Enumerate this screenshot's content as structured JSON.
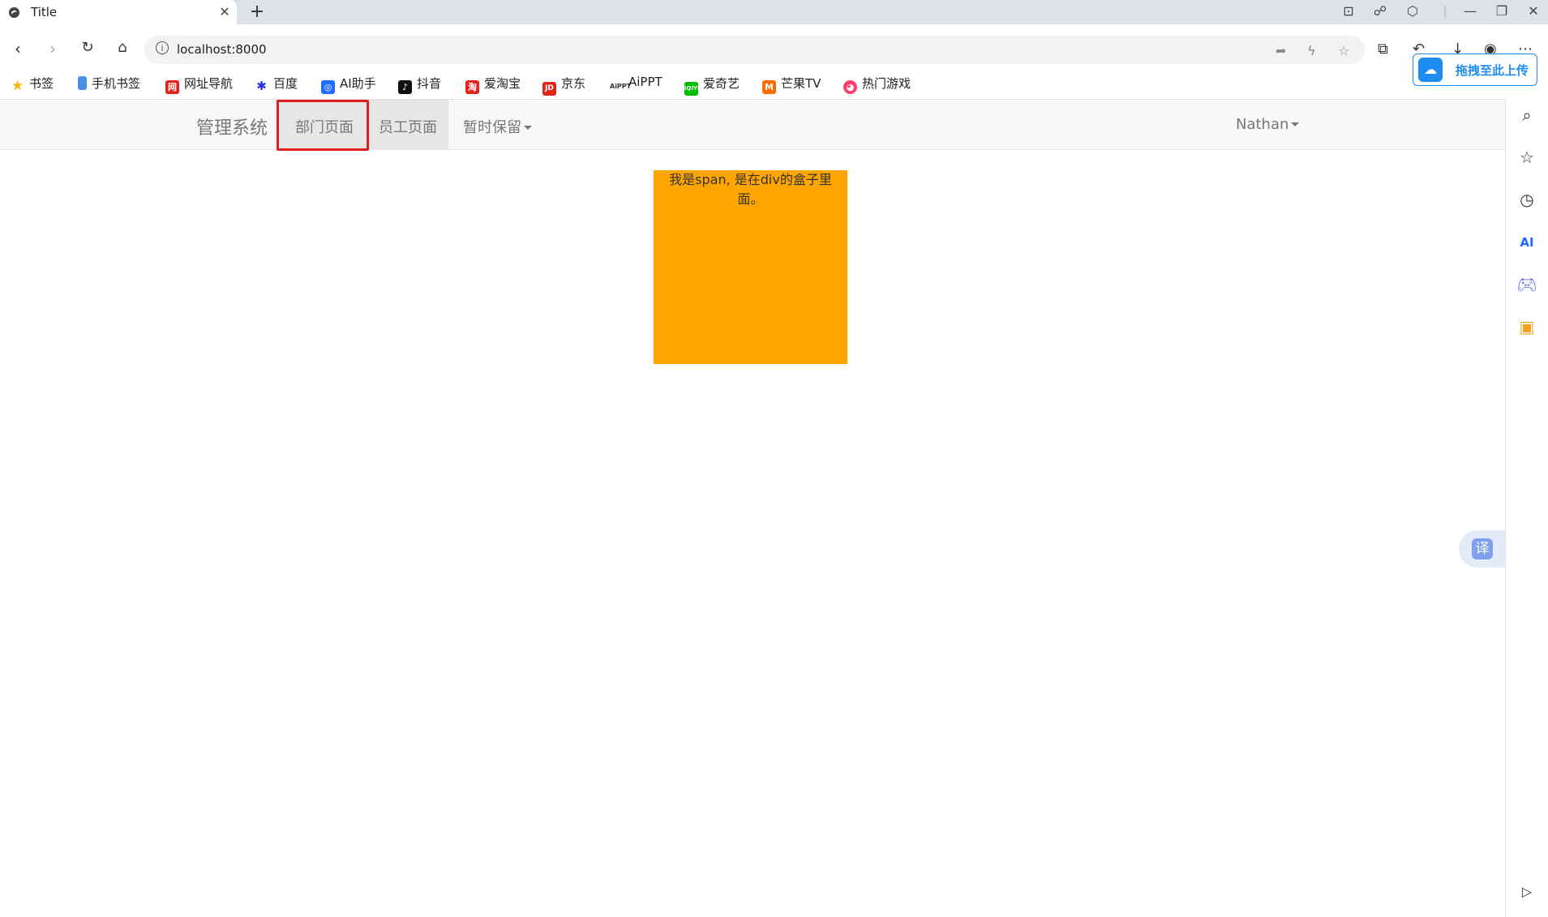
{
  "browser": {
    "tab_title": "Title",
    "url": "localhost:8000",
    "bookmarks": [
      {
        "label": "书签",
        "icon": "star-icon",
        "color": "#f5b400"
      },
      {
        "label": "手机书签",
        "icon": "phone-icon",
        "color": "#4a90e2"
      },
      {
        "label": "网址导航",
        "icon": "navigation-icon",
        "color": "#e2231a"
      },
      {
        "label": "百度",
        "icon": "baidu-paw-icon",
        "color": "#2932e1"
      },
      {
        "label": "AI助手",
        "icon": "ai-assistant-icon",
        "color": "#1e6cff"
      },
      {
        "label": "抖音",
        "icon": "douyin-icon",
        "color": "#111111"
      },
      {
        "label": "爱淘宝",
        "icon": "taobao-icon",
        "color": "#e2231a"
      },
      {
        "label": "京东",
        "icon": "jd-icon",
        "color": "#e1251b"
      },
      {
        "label": "AiPPT",
        "icon": "aippt-icon",
        "color": "#333333"
      },
      {
        "label": "爱奇艺",
        "icon": "iqiyi-icon",
        "color": "#00be06"
      },
      {
        "label": "芒果TV",
        "icon": "mangotv-icon",
        "color": "#ff6a00"
      },
      {
        "label": "热门游戏",
        "icon": "games-icon",
        "color": "#ff3e6c"
      }
    ],
    "upload_label": "拖拽至此上传",
    "translate_label": "译"
  },
  "navbar": {
    "brand": "管理系统",
    "items": [
      "部门页面",
      "员工页面",
      "暂时保留"
    ],
    "user": "Nathan"
  },
  "content": {
    "box_text": "我是span, 是在div的盒子里面。",
    "box_color": "#ffa500"
  }
}
